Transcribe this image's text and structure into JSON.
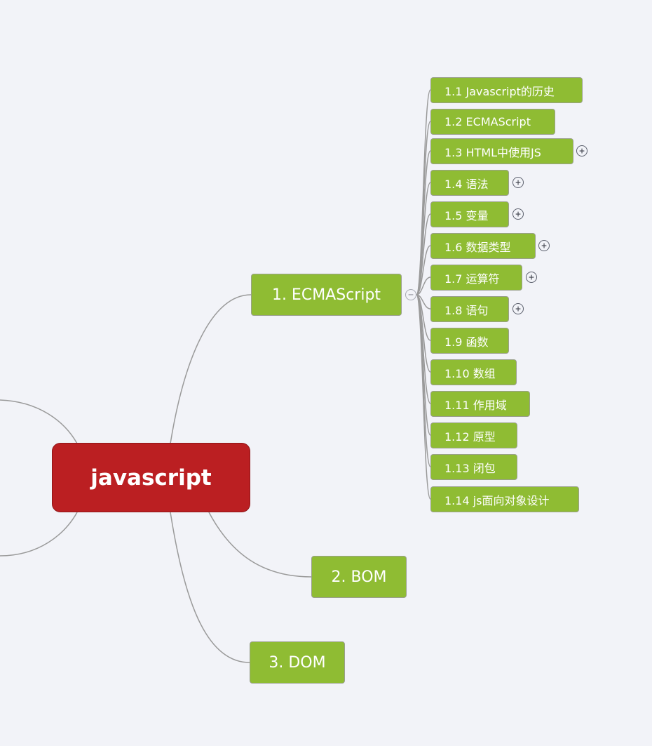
{
  "mindmap": {
    "root": {
      "label": "javascript"
    },
    "branches": [
      {
        "label": "1. ECMAScript",
        "toggle": "−",
        "children": [
          {
            "label": "1.1 Javascript的历史",
            "toggle": null
          },
          {
            "label": "1.2 ECMAScript",
            "toggle": null
          },
          {
            "label": "1.3 HTML中使用JS",
            "toggle": "+"
          },
          {
            "label": "1.4 语法",
            "toggle": "+"
          },
          {
            "label": "1.5 变量",
            "toggle": "+"
          },
          {
            "label": "1.6 数据类型",
            "toggle": "+"
          },
          {
            "label": "1.7 运算符",
            "toggle": "+"
          },
          {
            "label": "1.8 语句",
            "toggle": "+"
          },
          {
            "label": "1.9 函数",
            "toggle": null
          },
          {
            "label": "1.10 数组",
            "toggle": null
          },
          {
            "label": "1.11 作用域",
            "toggle": null
          },
          {
            "label": "1.12 原型",
            "toggle": null
          },
          {
            "label": "1.13 闭包",
            "toggle": null
          },
          {
            "label": "1.14 js面向对象设计",
            "toggle": null
          }
        ]
      },
      {
        "label": "2. BOM",
        "toggle": null,
        "children": []
      },
      {
        "label": "3. DOM",
        "toggle": null,
        "children": []
      }
    ],
    "colors": {
      "root": "#bb1f22",
      "topic": "#8fbc33",
      "connector": "#9a9a9a",
      "background": "#f2f3f8"
    }
  }
}
